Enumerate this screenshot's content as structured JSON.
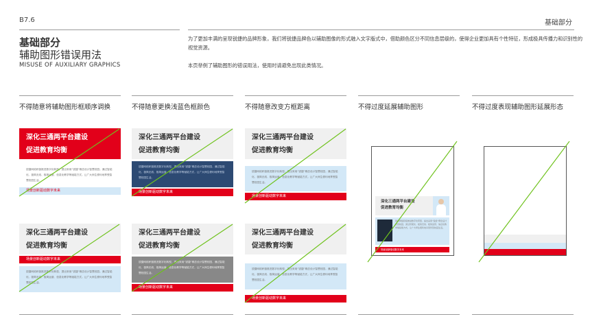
{
  "header": {
    "page_code": "B7.6",
    "section_label": "基础部分",
    "title_cn_1": "基础部分",
    "title_cn_2": "辅助图形错误用法",
    "title_en": "MISUSE OF AUXILIARY GRAPHICS"
  },
  "intro": {
    "paragraph_1": "为了更加丰满的呈现锐捷的品牌形象，我们将锐捷品牌色以辅助图像的形式融入文字版式中，借助颜色区分不同信息层级的，使得企业更加具有个性特征，形成极具传播力和识别性的视觉资源。",
    "paragraph_2": "本页举例了辅助图形的错误用法，使用时请避免出现此类情况。"
  },
  "columns": [
    {
      "title": "不得随意将辅助图形框顺序调换"
    },
    {
      "title": "不得随意更换浅蓝色框颜色"
    },
    {
      "title": "不得随意改变方框距离"
    },
    {
      "title": "不得过度延展辅助图形"
    },
    {
      "title": "不得过度表现辅助图形延展形态"
    }
  ],
  "sample": {
    "heading_line1": "深化三通两平台建设",
    "heading_line2": "促进教育均衡",
    "tag": "场景创新驱动数字未来",
    "body": "锐捷网络积极推进数字化转型，提出采用“锐捷”概念设计智慧校园，通过智能化、极简无线、极简运营、信息化教学等赋能方式，让广大师生便利地享受智慧校园生活。"
  },
  "colors": {
    "brand_red": "#e2001a",
    "light_blue": "#d3e8f7",
    "navy": "#2d4a73",
    "gray_box": "#f0f0f0",
    "dark_gray": "#888888",
    "slash_green": "#6fc21d"
  }
}
